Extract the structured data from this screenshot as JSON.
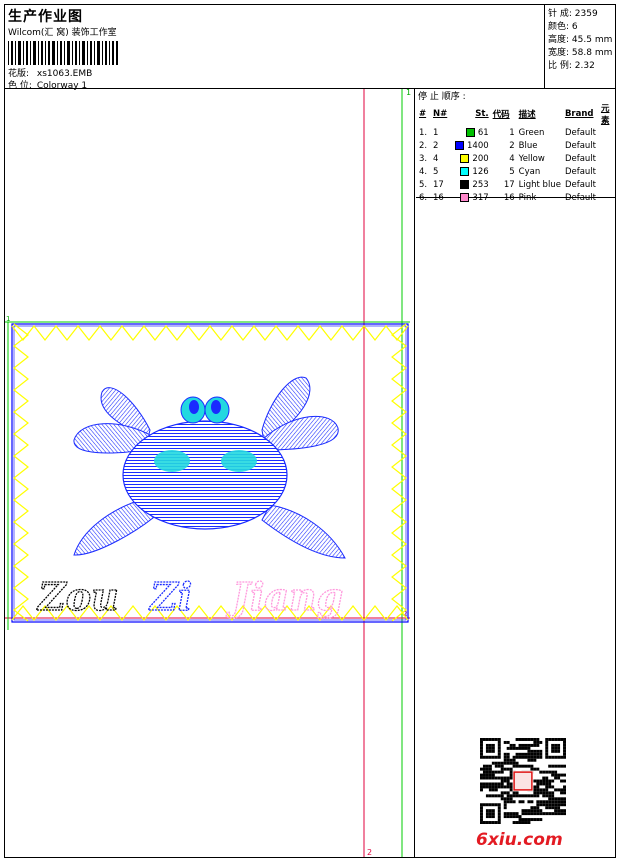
{
  "header": {
    "title": "生产作业图",
    "subtitle": "Wilcom(汇 窝) 装饰工作室",
    "design_label": "花版:",
    "design_value": "xs1063.EMB",
    "colorway_label": "色 位:",
    "colorway_value": "Colorway 1"
  },
  "stats": [
    {
      "label": "针 成:",
      "value": "2359"
    },
    {
      "label": "颜色:",
      "value": "6"
    },
    {
      "label": "高度:",
      "value": "45.5 mm"
    },
    {
      "label": "宽度:",
      "value": "58.8 mm"
    },
    {
      "label": "比 例:",
      "value": "2.32"
    }
  ],
  "stop_sequence": {
    "title": "停 止 顺序 :",
    "columns": [
      "#",
      "N#",
      "St.",
      "代码",
      "描述",
      "Brand",
      "元素"
    ],
    "rows": [
      {
        "idx": "1.",
        "n": "1",
        "st": "61",
        "code": "1",
        "desc": "Green",
        "brand": "Default",
        "color": "#00c000"
      },
      {
        "idx": "2.",
        "n": "2",
        "st": "1400",
        "code": "2",
        "desc": "Blue",
        "brand": "Default",
        "color": "#0000ff"
      },
      {
        "idx": "3.",
        "n": "4",
        "st": "200",
        "code": "4",
        "desc": "Yellow",
        "brand": "Default",
        "color": "#ffff00"
      },
      {
        "idx": "4.",
        "n": "5",
        "st": "126",
        "code": "5",
        "desc": "Cyan",
        "brand": "Default",
        "color": "#00ffff"
      },
      {
        "idx": "5.",
        "n": "17",
        "st": "253",
        "code": "17",
        "desc": "Light blue",
        "brand": "Default",
        "color": "#000000"
      },
      {
        "idx": "6.",
        "n": "16",
        "st": "317",
        "code": "16",
        "desc": "Pink",
        "brand": "Default",
        "color": "#ff88cc"
      }
    ]
  },
  "canvas": {
    "guide_top_label": "1",
    "guide_bottom_label": "2",
    "hoop_corner_label": "1",
    "hoop_corner_label_2": "2",
    "embroidery_text": "Zou Zi Jiang"
  },
  "footer": {
    "site": "6xiu.com"
  },
  "colors": {
    "guide_red": "#e0003c",
    "guide_green": "#00cc00",
    "hoop_blue": "#0000ff",
    "zigzag_yellow": "#ffff00",
    "crab_blue": "#1a2bff",
    "eye_cyan": "#22d8e0",
    "pink": "#ff99dd"
  }
}
